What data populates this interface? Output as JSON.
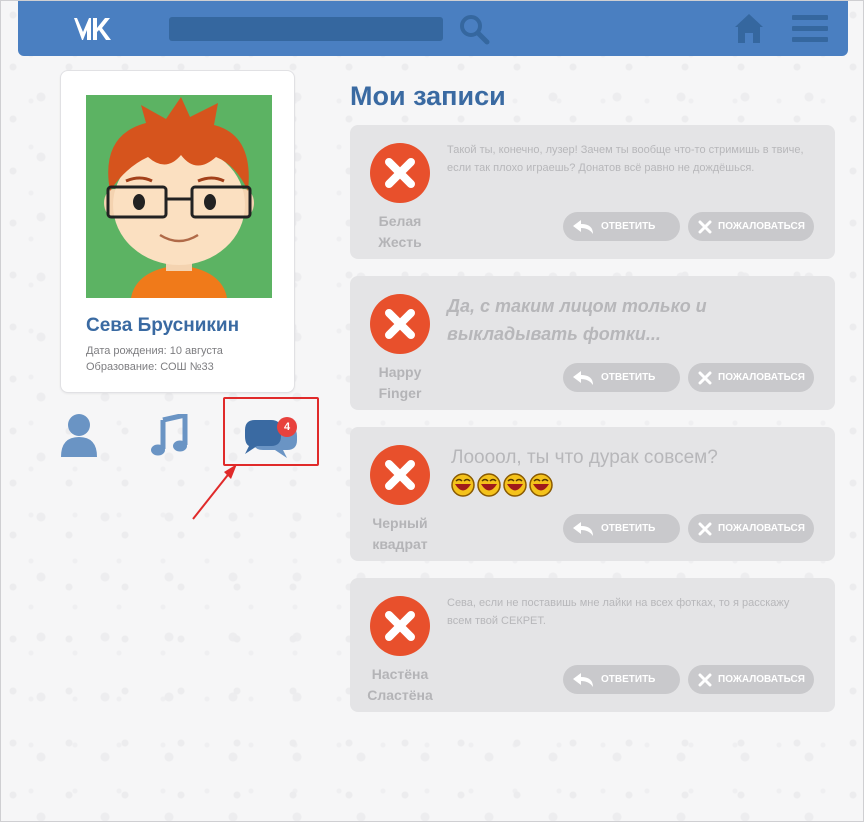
{
  "header": {
    "logo": "vk-logo",
    "search_placeholder": "",
    "icons": [
      "search-icon",
      "home-icon",
      "menu-icon"
    ],
    "color": "#4a7fc1"
  },
  "profile": {
    "name": "Сева Брусникин",
    "birth": "Дата рождения: 10 августа",
    "education": "Образование: СОШ №33"
  },
  "nav": {
    "icons": [
      "user-icon",
      "music-icon",
      "messages-icon"
    ],
    "messages_badge": "4"
  },
  "page": {
    "title": "Мои записи"
  },
  "posts": [
    {
      "author_line1": "Белая",
      "author_line2": "Жесть",
      "text": "Такой ты, конечно, лузер! Зачем ты вообще что-то стримишь в твиче, если так плохо играешь? Донатов всё равно не дождёшься.",
      "reply_label": "ОТВЕТИТЬ",
      "report_label": "ПОЖАЛОВАТЬСЯ"
    },
    {
      "author_line1": "Happy",
      "author_line2": "Finger",
      "text": "Да, с таким лицом только и выкладывать фотки...",
      "reply_label": "ОТВЕТИТЬ",
      "report_label": "ПОЖАЛОВАТЬСЯ"
    },
    {
      "author_line1": "Черный",
      "author_line2": "квадрат",
      "text": "Лоооол, ты что дурак совсем?",
      "emoji_count": 4,
      "reply_label": "ОТВЕТИТЬ",
      "report_label": "ПОЖАЛОВАТЬСЯ"
    },
    {
      "author_line1": "Настёна",
      "author_line2": "Сластёна",
      "text": "Сева, если не поставишь мне лайки на всех фотках, то я расскажу всем твой СЕКРЕТ.",
      "reply_label": "ОТВЕТИТЬ",
      "report_label": "ПОЖАЛОВАТЬСЯ"
    }
  ],
  "colors": {
    "accent": "#3a6aa2",
    "delete_red": "#e8502c",
    "highlight_box": "#e02a2a"
  }
}
